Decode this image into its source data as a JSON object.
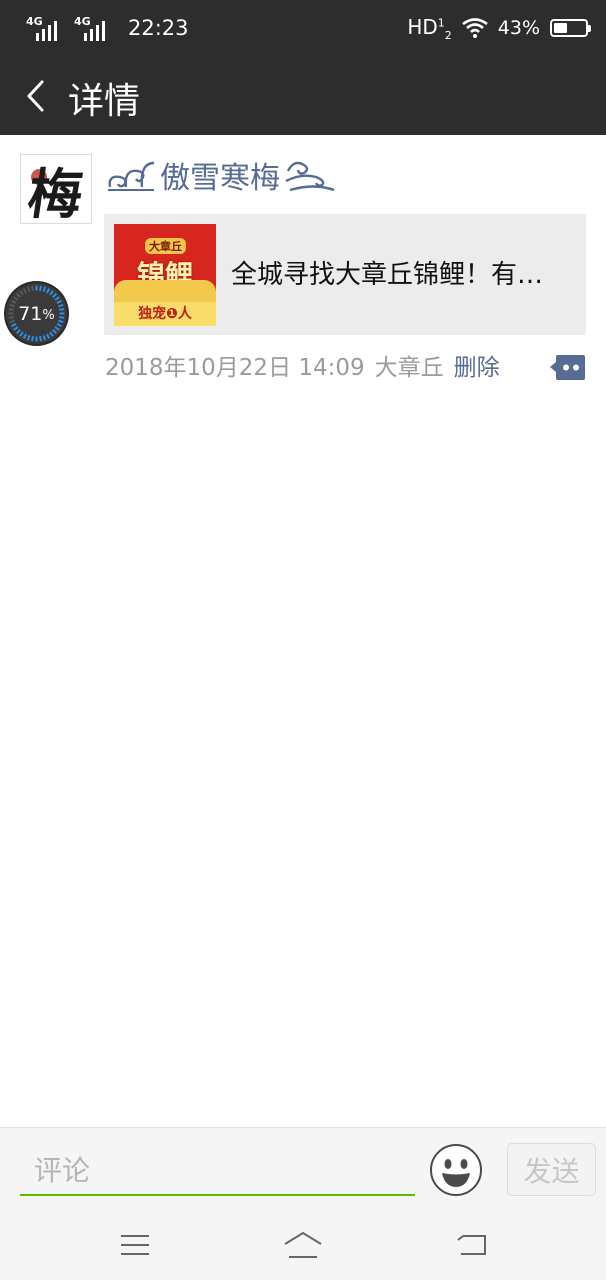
{
  "status_bar": {
    "signal_1": "4G",
    "signal_2": "4G",
    "time": "22:23",
    "hd": "HD",
    "hd_sup": "1",
    "hd_sub": "2",
    "battery_percent": "43%",
    "battery_level": 0.43
  },
  "app_bar": {
    "title": "详情"
  },
  "post": {
    "avatar_char": "梅",
    "nickname": "傲雪寒梅",
    "link_card": {
      "thumb_badge": "大章丘",
      "thumb_big": "锦鲤",
      "thumb_slogan": "独宠❶人",
      "title": "全城寻找大章丘锦鲤！有…"
    },
    "time": "2018年10月22日 14:09",
    "location": "大章丘",
    "delete_label": "删除"
  },
  "boost_widget": {
    "value": "71",
    "unit": "%",
    "level": 0.71
  },
  "input_bar": {
    "placeholder": "评论",
    "send_label": "发送"
  },
  "colors": {
    "accent_link": "#576b95",
    "input_underline": "#62b900",
    "dark_bar": "#2d2d2d"
  },
  "icons": {
    "back": "chevron-left-icon",
    "comment": "more-comment-icon",
    "emoji": "smiley-icon",
    "nav_menu": "menu-icon",
    "nav_home": "home-icon",
    "nav_back": "return-icon"
  }
}
